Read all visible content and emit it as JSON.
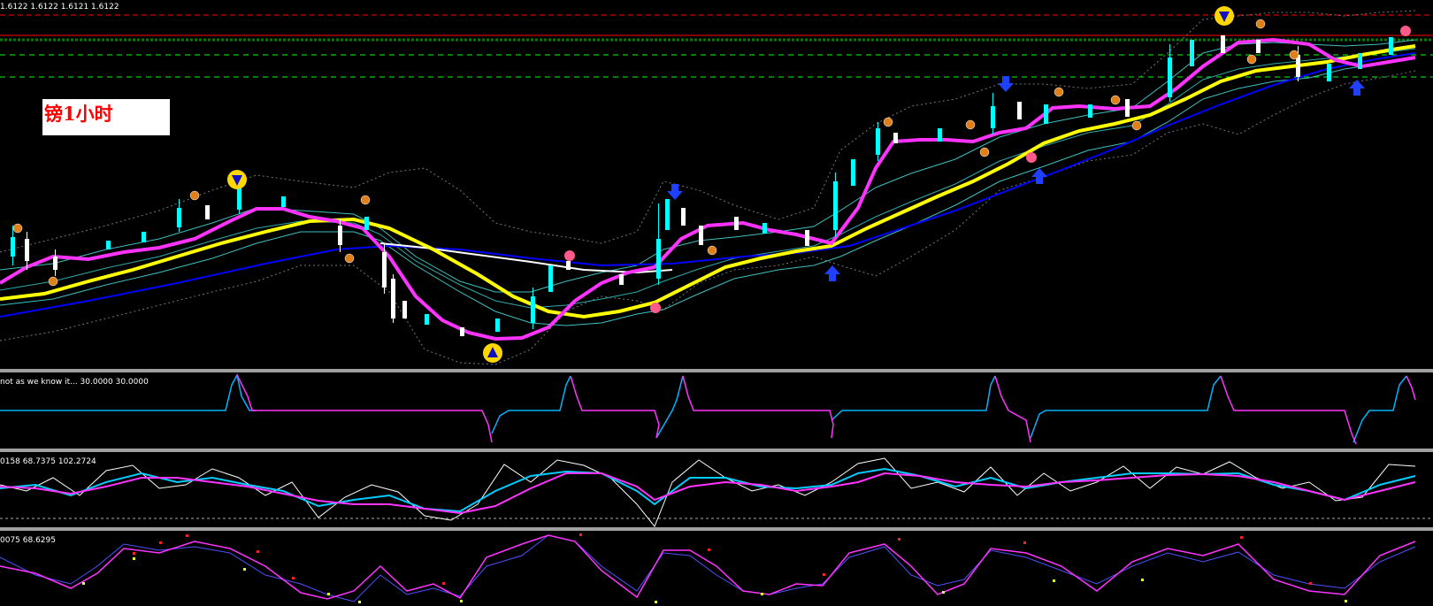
{
  "chart_data": [
    {
      "type": "line",
      "title": "镑1小时",
      "header_readout": "1.6122 1.6122 1.6121 1.6122",
      "colors": {
        "background": "#000000",
        "candle_up": "#00ffff",
        "candle_down": "#ffffff",
        "price_ma": "#ff00ff",
        "ma_mid": "#ffff00",
        "ma_slow": "#0000ff",
        "band": "#40c0c0",
        "envelope": "#888888",
        "resistance": "#ff0000",
        "support": "#00ff00"
      },
      "overlays": [
        "price-ma",
        "middle-ma",
        "slow-ma",
        "channel-bands",
        "dotted-envelope",
        "arrow-markers",
        "candlesticks"
      ],
      "horizontal_levels": [
        "red-dashed",
        "red-solid",
        "green-dashed",
        "green-dashed"
      ],
      "grid": false
    },
    {
      "type": "line",
      "title": "not as we know it... 30.0000 30.0000",
      "series": [
        {
          "values": []
        }
      ]
    },
    {
      "type": "line",
      "title": "0158 68.7375 102.2724",
      "series": [
        {
          "values": []
        }
      ]
    },
    {
      "type": "line",
      "title": "0075 68.6295",
      "series": [
        {
          "values": []
        }
      ]
    }
  ]
}
